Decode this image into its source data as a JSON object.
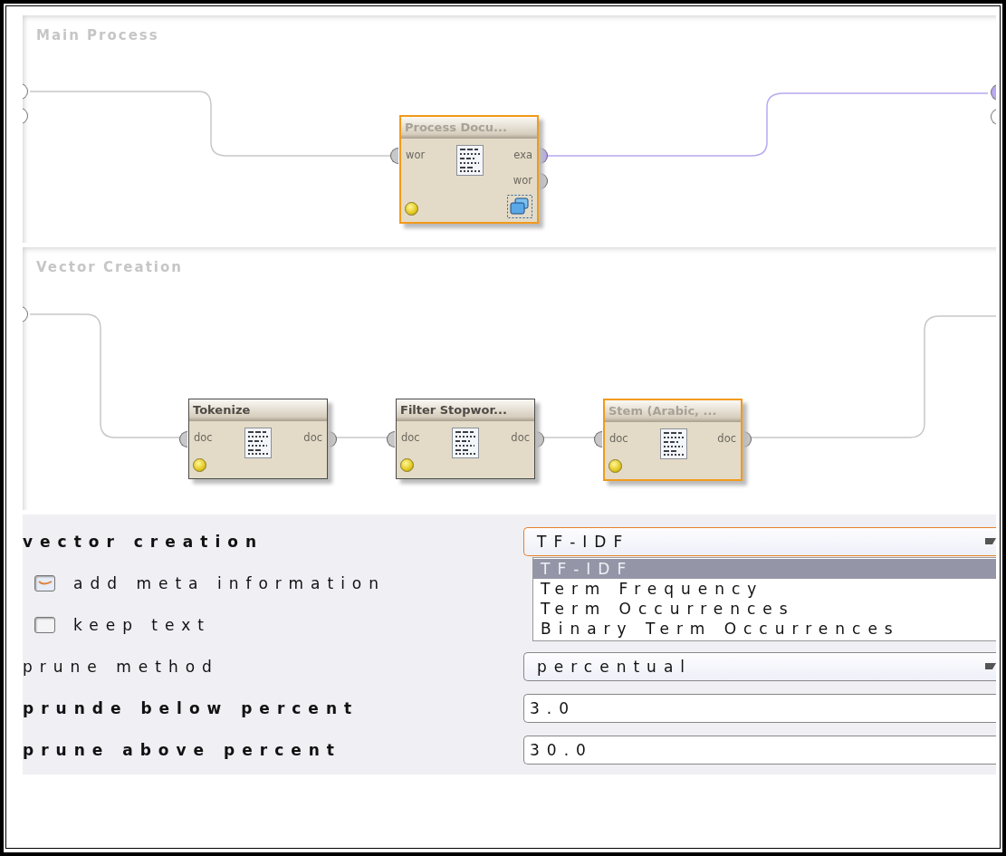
{
  "processes": [
    {
      "title": "Main Process",
      "source_ports": [
        {
          "color": "#ffffff"
        },
        {
          "color": "#ffffff"
        }
      ],
      "sink_ports": [
        {
          "color": "#b8a8f0"
        },
        {
          "color": "#ffffff"
        }
      ],
      "operators": [
        {
          "name": "Process Docu...",
          "selected": true,
          "subprocess": true,
          "inputs": [
            {
              "label": "wor",
              "color": "#c8c8c8"
            }
          ],
          "outputs": [
            {
              "label": "exa",
              "color": "#b8a8f0"
            },
            {
              "label": "wor",
              "color": "#c8c8c8"
            }
          ]
        }
      ]
    },
    {
      "title": "Vector Creation",
      "source_ports": [
        {
          "color": "#ffffff"
        }
      ],
      "operators": [
        {
          "name": "Tokenize",
          "selected": false,
          "subprocess": false,
          "inputs": [
            {
              "label": "doc",
              "color": "#c8c8c8"
            }
          ],
          "outputs": [
            {
              "label": "doc",
              "color": "#c8c8c8"
            }
          ]
        },
        {
          "name": "Filter Stopwor...",
          "selected": false,
          "subprocess": false,
          "inputs": [
            {
              "label": "doc",
              "color": "#c8c8c8"
            }
          ],
          "outputs": [
            {
              "label": "doc",
              "color": "#c8c8c8"
            }
          ]
        },
        {
          "name": "Stem (Arabic, ...",
          "selected": true,
          "subprocess": false,
          "inputs": [
            {
              "label": "doc",
              "color": "#c8c8c8"
            }
          ],
          "outputs": [
            {
              "label": "doc",
              "color": "#c8c8c8"
            }
          ]
        }
      ]
    }
  ],
  "parameters": [
    {
      "kind": "dropdown",
      "label": "vector creation",
      "bold": true,
      "value": "TF-IDF",
      "focused": true,
      "options": [
        {
          "label": "TF-IDF",
          "selected": true
        },
        {
          "label": "Term Frequency",
          "selected": false
        },
        {
          "label": "Term Occurrences",
          "selected": false
        },
        {
          "label": "Binary Term Occurrences",
          "selected": false
        }
      ]
    },
    {
      "kind": "checkbox",
      "label": "add meta information",
      "checked": true
    },
    {
      "kind": "checkbox",
      "label": "keep text",
      "checked": false
    },
    {
      "kind": "dropdown",
      "label": "prune method",
      "bold": false,
      "value": "percentual",
      "focused": false
    },
    {
      "kind": "text",
      "label": "prunde below percent",
      "bold": true,
      "value": "3.0"
    },
    {
      "kind": "text",
      "label": "prune above percent",
      "bold": true,
      "value": "30.0"
    }
  ]
}
